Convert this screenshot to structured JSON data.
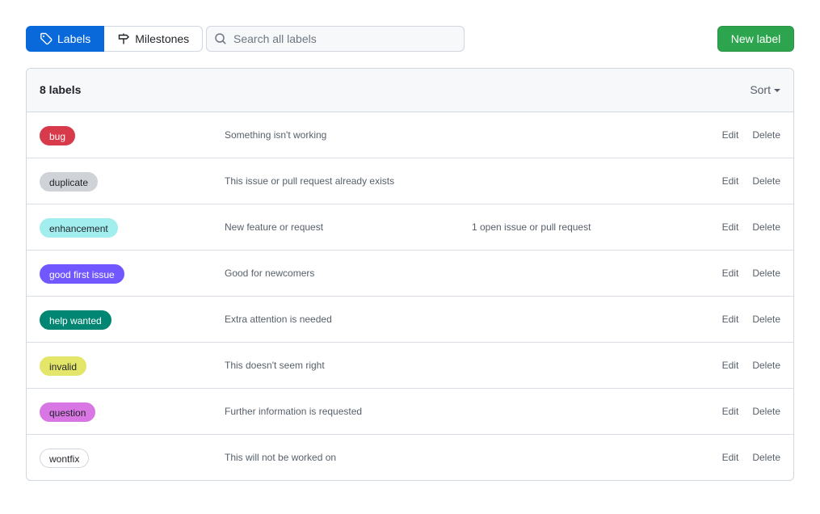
{
  "nav": {
    "labels_tab": "Labels",
    "milestones_tab": "Milestones"
  },
  "search": {
    "placeholder": "Search all labels"
  },
  "new_label_button": "New label",
  "list": {
    "count_title": "8 labels",
    "sort_label": "Sort",
    "edit_label": "Edit",
    "delete_label": "Delete",
    "items": [
      {
        "name": "bug",
        "description": "Something isn't working",
        "issues": "",
        "color": "#d73a4a",
        "text_color": "#ffffff",
        "border": "#d73a4a"
      },
      {
        "name": "duplicate",
        "description": "This issue or pull request already exists",
        "issues": "",
        "color": "#cfd3d7",
        "text_color": "#1f2328",
        "border": "#cfd3d7"
      },
      {
        "name": "enhancement",
        "description": "New feature or request",
        "issues": "1 open issue or pull request",
        "color": "#a2eeef",
        "text_color": "#1f2328",
        "border": "#a2eeef"
      },
      {
        "name": "good first issue",
        "description": "Good for newcomers",
        "issues": "",
        "color": "#7057ff",
        "text_color": "#ffffff",
        "border": "#7057ff"
      },
      {
        "name": "help wanted",
        "description": "Extra attention is needed",
        "issues": "",
        "color": "#008672",
        "text_color": "#ffffff",
        "border": "#008672"
      },
      {
        "name": "invalid",
        "description": "This doesn't seem right",
        "issues": "",
        "color": "#e4e669",
        "text_color": "#1f2328",
        "border": "#e4e669"
      },
      {
        "name": "question",
        "description": "Further information is requested",
        "issues": "",
        "color": "#d876e3",
        "text_color": "#1f2328",
        "border": "#d876e3"
      },
      {
        "name": "wontfix",
        "description": "This will not be worked on",
        "issues": "",
        "color": "#ffffff",
        "text_color": "#1f2328",
        "border": "#d0d7de"
      }
    ]
  },
  "icons": {
    "labels_tab": "tag-icon",
    "milestones_tab": "milestone-icon",
    "search": "search-icon",
    "sort": "caret-down-icon"
  }
}
